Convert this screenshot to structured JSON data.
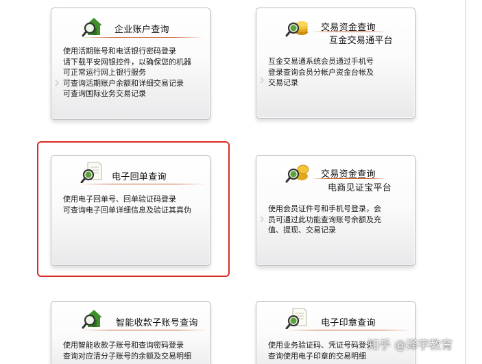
{
  "cards": [
    {
      "title": "企业账户查询",
      "subtitle": "",
      "icon": "house-search-icon",
      "lines": [
        "使用活期账号和电话银行密码登录",
        "请下载平安网银控件，以确保您的机器",
        "可正常运行网上银行服务",
        "可查询活期账户余额和详细交易记录",
        "可查询国际业务交易记录"
      ]
    },
    {
      "title": "交易资金查询",
      "subtitle": "互金交易通平台",
      "icon": "coins-search-icon",
      "lines": [
        "互金交易通系统会员通过手机号",
        "登录查询会员分帐户资金台帐及",
        "交易记录"
      ]
    },
    {
      "title": "电子回单查询",
      "subtitle": "",
      "icon": "document-search-icon",
      "lines": [
        "使用电子回单号、回单验证码登录",
        "可查询电子回单详细信息及验证其真伪"
      ]
    },
    {
      "title": "交易资金查询",
      "subtitle": "电商见证宝平台",
      "icon": "coins-search-icon",
      "lines": [
        "使用会员证件号和手机号登录，会",
        "员可通过此功能查询账号余额及充",
        "值、提现、交易记录"
      ]
    },
    {
      "title": "智能收款子账号查询",
      "subtitle": "",
      "icon": "house-search-icon",
      "lines": [
        "使用智能收款子账号和查询密码登录",
        "查询对应清分子账号的余额及交易明细"
      ]
    },
    {
      "title": "电子印章查询",
      "subtitle": "",
      "icon": "document-search-icon",
      "lines": [
        "使用业务验证码、凭证号码登录",
        "查询使用电子印章的交易明细"
      ]
    }
  ],
  "watermark": "知乎 @泽宇教育",
  "colors": {
    "highlight": "#d92a22",
    "title_rule": "#c85a28",
    "icon_green": "#3f8f2a",
    "coin_gold": "#e0a81c"
  }
}
